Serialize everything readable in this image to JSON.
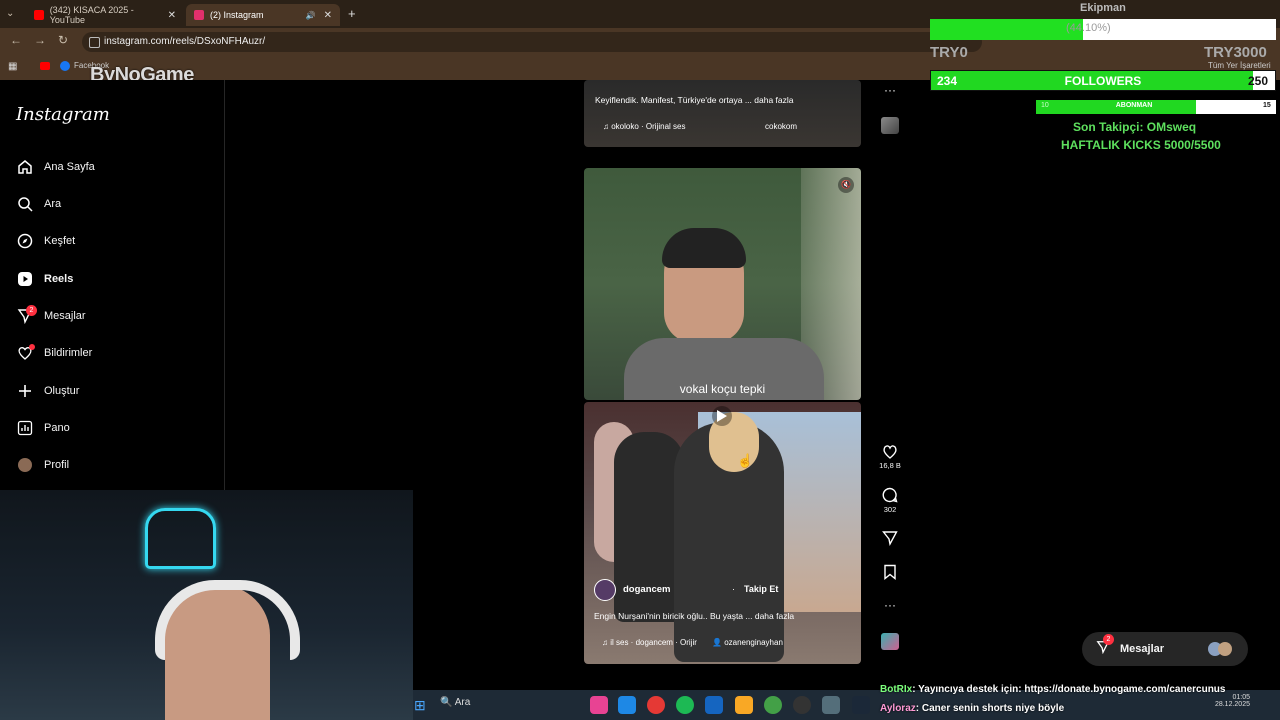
{
  "browser": {
    "tabs": [
      {
        "label": "(342) KISACA 2025 - YouTube",
        "active": false,
        "color": "#ff0000"
      },
      {
        "label": "(2) Instagram",
        "active": true,
        "color": "#e1306c"
      }
    ],
    "url": "instagram.com/reels/DSxoNFHAuzr/",
    "bookmarks": {
      "left_label": "Facebook",
      "right_label": "Tüm Yer İşaretleri"
    }
  },
  "watermark": "ByNoGame",
  "instagram": {
    "logo": "Instagram",
    "nav": [
      {
        "label": "Ana Sayfa",
        "icon": "home-icon"
      },
      {
        "label": "Ara",
        "icon": "search-icon"
      },
      {
        "label": "Keşfet",
        "icon": "compass-icon"
      },
      {
        "label": "Reels",
        "icon": "reels-icon",
        "active": true
      },
      {
        "label": "Mesajlar",
        "icon": "messenger-icon",
        "badge": "2"
      },
      {
        "label": "Bildirimler",
        "icon": "heart-icon",
        "dot": true
      },
      {
        "label": "Oluştur",
        "icon": "plus-icon"
      },
      {
        "label": "Pano",
        "icon": "dashboard-icon"
      },
      {
        "label": "Profil",
        "icon": "avatar-icon"
      }
    ],
    "reel_top": {
      "caption": "Keyiflendik. Manifest, Türkiye'de ortaya ... daha fazla",
      "audio": "okoloko · Orijinal ses",
      "tag": "cokokom"
    },
    "reel_main": {
      "subtitle": "vokal koçu tepki",
      "username": "dogancem",
      "follow": "Takip Et",
      "caption": "Engin Nurşani'nin biricik oğlu.. Bu yaşta ... daha fazla",
      "audio": "il ses · dogancem · Orijir",
      "tagged": "ozanenginayhan",
      "likes": "16,8 B",
      "comments": "302"
    },
    "messages_button": "Mesajlar",
    "messages_badge": "2"
  },
  "stream_overlay": {
    "goal_title": "Ekipman",
    "goal_progress_text": "44.10%",
    "goal_progress": 0.441,
    "goal_left": "TRY0",
    "goal_right": "TRY3000",
    "followers_current": "234",
    "followers_label": "FOLLOWERS",
    "followers_target": "250",
    "followers_progress": 0.936,
    "subs_current": "10",
    "subs_label": "ABONMAN",
    "subs_target": "15",
    "subs_progress": 0.667,
    "last_follower": "Son Takipçi: OMsweq",
    "weekly_kicks": "HAFTALIK KICKS 5000/5500",
    "chat": [
      {
        "user": "BotRIx",
        "text": ": Yayıncıya destek için: https://donate.bynogame.com/canercunus"
      },
      {
        "user": "Ayloraz",
        "text": ": Caner senin shorts niye böyle"
      }
    ]
  },
  "taskbar": {
    "search": "Ara",
    "time": "01:05",
    "date": "28.12.2025"
  }
}
